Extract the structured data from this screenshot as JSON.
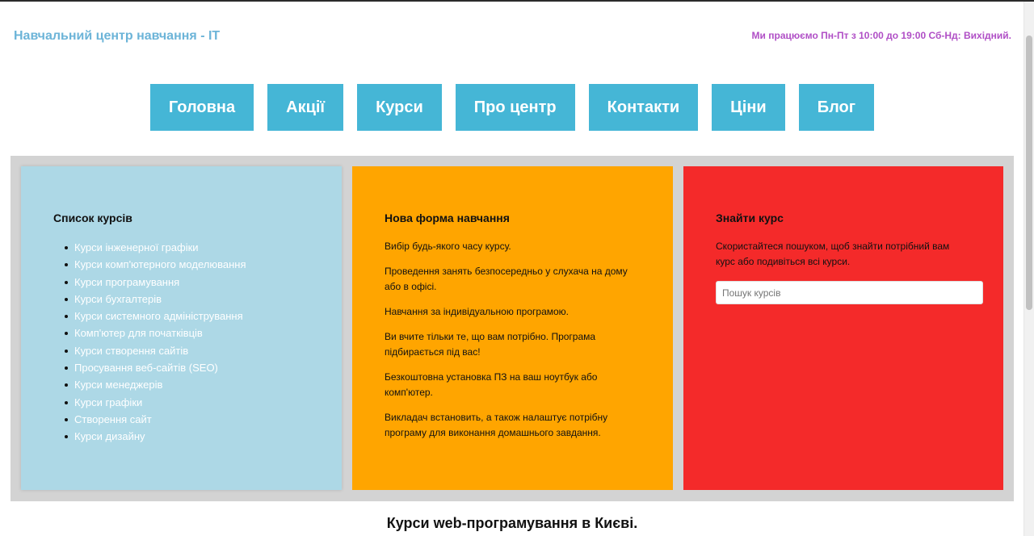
{
  "header": {
    "site_title": "Навчальний центр навчання - IT",
    "hours": "Ми працюємо Пн-Пт з 10:00 до 19:00 Сб-Нд: Вихідний."
  },
  "nav": {
    "items": [
      {
        "label": "Головна"
      },
      {
        "label": "Акції"
      },
      {
        "label": "Курси"
      },
      {
        "label": "Про центр"
      },
      {
        "label": "Контакти"
      },
      {
        "label": "Ціни"
      },
      {
        "label": "Блог"
      }
    ]
  },
  "courses": {
    "title": "Список курсів",
    "items": [
      "Курси інженерної графіки",
      "Курси комп'ютерного моделювання",
      "Курси програмування",
      "Курси бухгалтерів",
      "Курси системного адміністрування",
      "Комп'ютер для початківців",
      "Курси створення сайтів",
      "Просування веб-сайтів (SEO)",
      "Курси менеджерів",
      "Курси графіки",
      "Створення сайт",
      "Курси дизайну"
    ]
  },
  "new_form": {
    "title": "Нова форма навчання",
    "paragraphs": [
      "Вибір будь-якого часу курсу.",
      "Проведення занять безпосередньо у слухача на дому або в офісі.",
      "Навчання за індивідуальною програмою.",
      "Ви вчите тільки те, що вам потрібно. Програма підбирається під вас!",
      "Безкоштовна установка ПЗ на ваш ноутбук або комп'ютер.",
      "Викладач встановить, а також налаштує потрібну програму для виконання домашнього завдання."
    ]
  },
  "search": {
    "title": "Знайти курс",
    "description": "Скористайтеся пошуком, щоб знайти потрібний вам курс або подивіться всі курси.",
    "placeholder": "Пошук курсів",
    "value": ""
  },
  "section": {
    "heading": "Курси web-програмування в Києві."
  },
  "colors": {
    "title_blue": "#6cb4d8",
    "hours_purple": "#b04fc6",
    "nav_button": "#45b6d6",
    "panel_bg": "#d3d3d3",
    "card_blue": "#add8e6",
    "card_orange": "#ffa500",
    "card_red": "#f42a2a"
  }
}
